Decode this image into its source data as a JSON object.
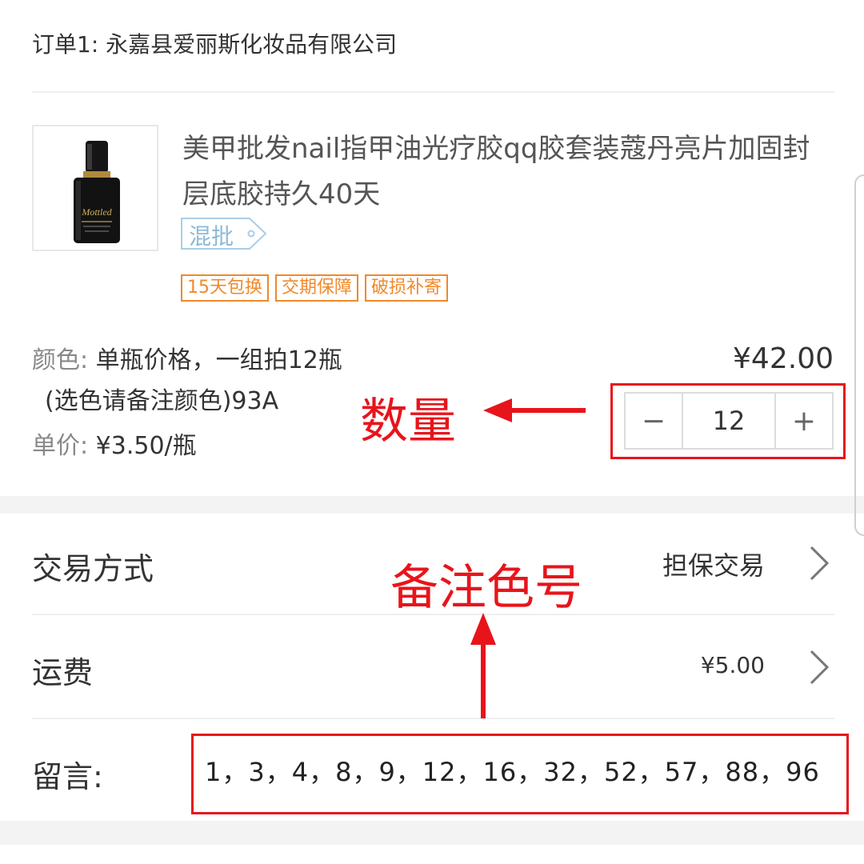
{
  "order": {
    "header": "订单1: 永嘉县爱丽斯化妆品有限公司"
  },
  "product": {
    "title": "美甲批发nail指甲油光疗胶qq胶套装蔻丹亮片加固封层底胶持久40天",
    "mix_tag": "混批",
    "thumbnail_brand": "Mottled",
    "badges": [
      "15天包换",
      "交期保障",
      "破损补寄"
    ],
    "color_key": "颜色: ",
    "color_value_line1": "单瓶价格，一组拍12瓶",
    "color_value_line2": "(选色请备注颜色)93A",
    "unit_price_key": "单价: ",
    "unit_price_value": "¥3.50/瓶",
    "total_price": "¥42.00",
    "quantity": "12",
    "minus_symbol": "−",
    "plus_symbol": "+"
  },
  "annotations": {
    "quantity_label": "数量",
    "note_color_label": "备注色号",
    "color": "#e8141b"
  },
  "trade": {
    "label": "交易方式",
    "value": "担保交易"
  },
  "shipping": {
    "label": "运费",
    "value": "¥5.00"
  },
  "message": {
    "label": "留言:",
    "value": "1，3，4，8，9，12，16，32，52，57，88，96"
  },
  "icons": {
    "chevron": "chevron-right-icon",
    "arrow_left": "arrow-left-icon",
    "arrow_up": "arrow-up-icon"
  }
}
